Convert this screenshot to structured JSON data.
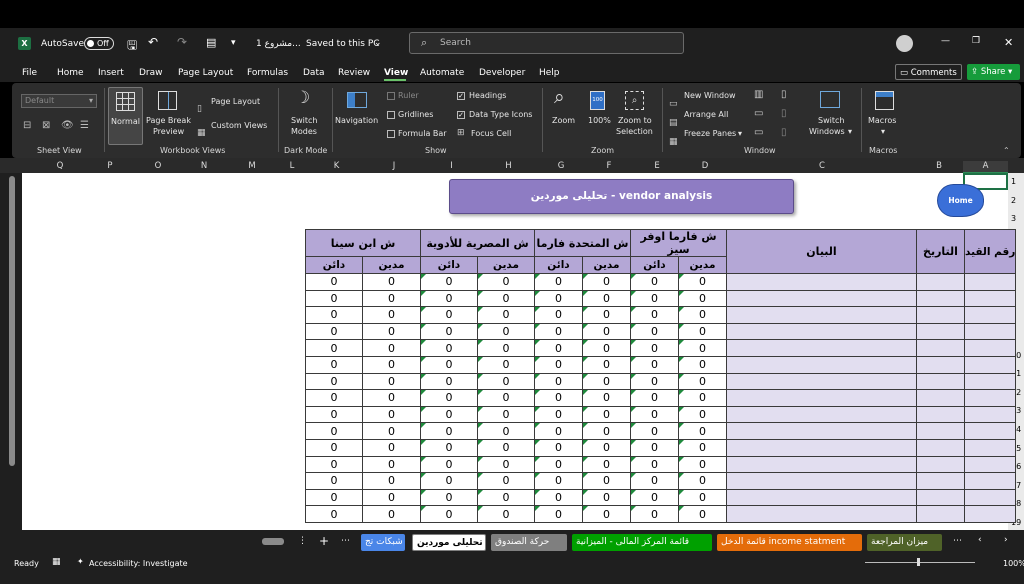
{
  "titlebar": {
    "autosave_label": "AutoSave",
    "autosave_state": "Off",
    "doc_title": "1 مشروع...",
    "save_status": "Saved to this PC",
    "search_placeholder": "Search"
  },
  "menu": {
    "items": [
      "File",
      "Home",
      "Insert",
      "Draw",
      "Page Layout",
      "Formulas",
      "Data",
      "Review",
      "View",
      "Automate",
      "Developer",
      "Help"
    ],
    "active": "View",
    "comments": "Comments",
    "share": "Share"
  },
  "ribbon": {
    "sheet_view": {
      "dropdown": "Default",
      "label": "Sheet View"
    },
    "workbook_views": {
      "normal": "Normal",
      "page_break": "Page Break",
      "preview": "Preview",
      "page_layout": "Page Layout",
      "custom_views": "Custom Views",
      "label": "Workbook Views"
    },
    "dark_mode": {
      "switch": "Switch",
      "modes": "Modes",
      "label": "Dark Mode"
    },
    "show": {
      "navigation": "Navigation",
      "ruler": "Ruler",
      "gridlines": "Gridlines",
      "formula_bar": "Formula Bar",
      "headings": "Headings",
      "data_type_icons": "Data Type Icons",
      "focus_cell": "Focus Cell",
      "label": "Show"
    },
    "zoom": {
      "zoom": "Zoom",
      "pct": "100%",
      "zoom_to": "Zoom to",
      "selection": "Selection",
      "label": "Zoom"
    },
    "window": {
      "new_window": "New Window",
      "arrange_all": "Arrange All",
      "freeze_panes": "Freeze Panes",
      "switch": "Switch",
      "windows": "Windows",
      "label": "Window"
    },
    "macros": {
      "macros": "Macros",
      "label": "Macros"
    }
  },
  "columns": [
    "Q",
    "P",
    "O",
    "N",
    "M",
    "L",
    "K",
    "J",
    "I",
    "H",
    "G",
    "F",
    "E",
    "D",
    "C",
    "B",
    "A"
  ],
  "rows": [
    "1",
    "2",
    "3",
    "4",
    "5",
    "6",
    "7",
    "8",
    "9",
    "10",
    "11",
    "12",
    "13",
    "14",
    "15",
    "16",
    "17",
    "18",
    "19"
  ],
  "sheet": {
    "title": "تحليلى موردين - vendor analysis",
    "home_button": "Home",
    "headers": {
      "entry_no": "رقم القيد",
      "date": "التاريخ",
      "statement": "البيان",
      "vendors": [
        "ش فارما اوفر سيز",
        "ش المتحدة فارما",
        "ش المصرية للأدوية",
        "ش ابن سينا"
      ],
      "debit": "مدين",
      "credit": "دائن"
    },
    "zero": "0"
  },
  "tabs": [
    "ميزان المراجعة",
    "قائمة الدخل income statment",
    "قائمة المركز المالى - الميزانية",
    "حركة الصندوق",
    "تحليلى موردين",
    "شبكات تج"
  ],
  "tab_colors": [
    "#4f6228",
    "#e46c0a",
    "#00a000",
    "#7f7f7f",
    "#ffffff",
    "#4a86e8"
  ],
  "status": {
    "ready": "Ready",
    "accessibility": "Accessibility: Investigate",
    "zoom": "100%"
  }
}
